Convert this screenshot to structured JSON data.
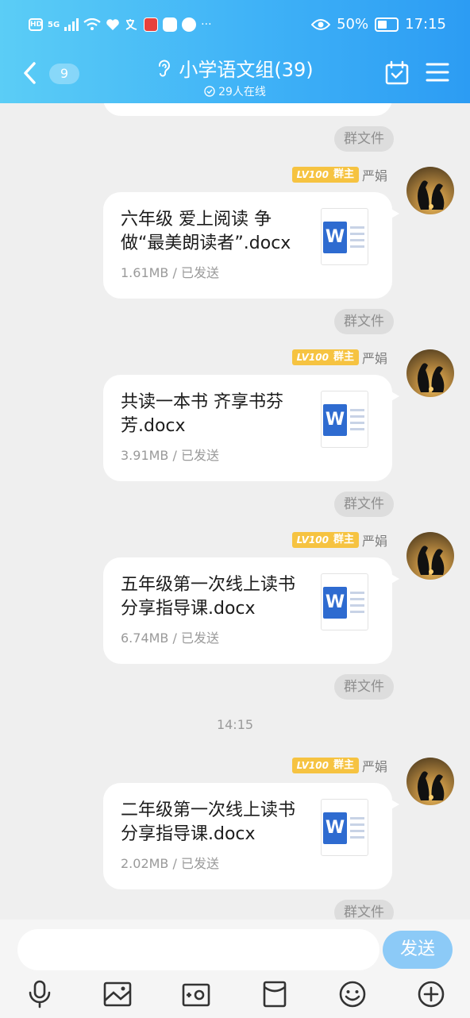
{
  "status_bar": {
    "hd": "HD",
    "net": "5G",
    "more": "···",
    "battery": "50%",
    "time": "17:15"
  },
  "header": {
    "unread_count": "9",
    "title": "小学语文组(39)",
    "online": "29人在线"
  },
  "chat": {
    "time_divider": "14:15",
    "group_file_label": "群文件",
    "messages": [
      {
        "level": "LV100",
        "role": "群主",
        "sender": "严娟",
        "file_name": "六年级 爱上阅读 争做“最美朗读者”.docx",
        "file_meta": "1.61MB / 已发送",
        "file_icon": "W"
      },
      {
        "level": "LV100",
        "role": "群主",
        "sender": "严娟",
        "file_name": "共读一本书 齐享书芬芳.docx",
        "file_meta": "3.91MB / 已发送",
        "file_icon": "W"
      },
      {
        "level": "LV100",
        "role": "群主",
        "sender": "严娟",
        "file_name": "五年级第一次线上读书分享指导课.docx",
        "file_meta": "6.74MB / 已发送",
        "file_icon": "W"
      },
      {
        "level": "LV100",
        "role": "群主",
        "sender": "严娟",
        "file_name": "二年级第一次线上读书分享指导课.docx",
        "file_meta": "2.02MB / 已发送",
        "file_icon": "W"
      }
    ]
  },
  "input": {
    "send_label": "发送"
  },
  "toolbar": {
    "icons": [
      "microphone-icon",
      "image-icon",
      "camera-icon",
      "red-packet-icon",
      "emoji-icon",
      "plus-icon"
    ]
  },
  "colors": {
    "header_start": "#5bcdf6",
    "header_end": "#2c9cf3",
    "tag": "#f6c341",
    "send_button": "#8ccaf7",
    "word_blue": "#2e6bd0"
  }
}
